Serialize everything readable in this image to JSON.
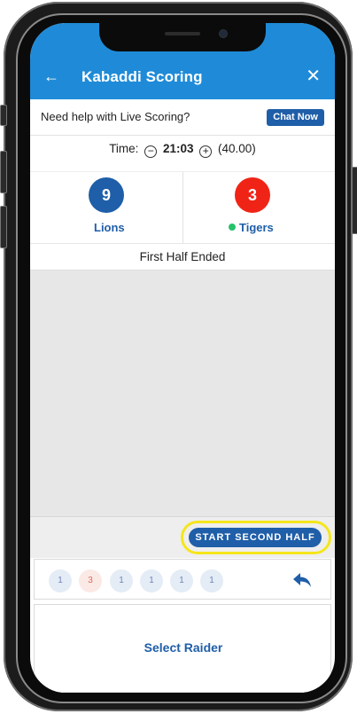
{
  "header": {
    "title": "Kabaddi Scoring",
    "back_icon": "←",
    "close_icon": "✕",
    "color": "#1f8bd8"
  },
  "help": {
    "text": "Need help with Live Scoring?",
    "button": "Chat Now"
  },
  "timer": {
    "label": "Time:",
    "value": "21:03",
    "total": "(40.00)"
  },
  "teams": [
    {
      "name": "Lions",
      "score": "9",
      "color": "#1f5ea8"
    },
    {
      "name": "Tigers",
      "score": "3",
      "color": "#f02416",
      "active": true
    }
  ],
  "status": "First Half Ended",
  "action_button": "START SECOND HALF",
  "history": [
    {
      "value": "1",
      "style": "blue"
    },
    {
      "value": "3",
      "style": "red"
    },
    {
      "value": "1",
      "style": "blue"
    },
    {
      "value": "1",
      "style": "blue"
    },
    {
      "value": "1",
      "style": "blue"
    },
    {
      "value": "1",
      "style": "blue"
    }
  ],
  "raider_label": "Select Raider"
}
